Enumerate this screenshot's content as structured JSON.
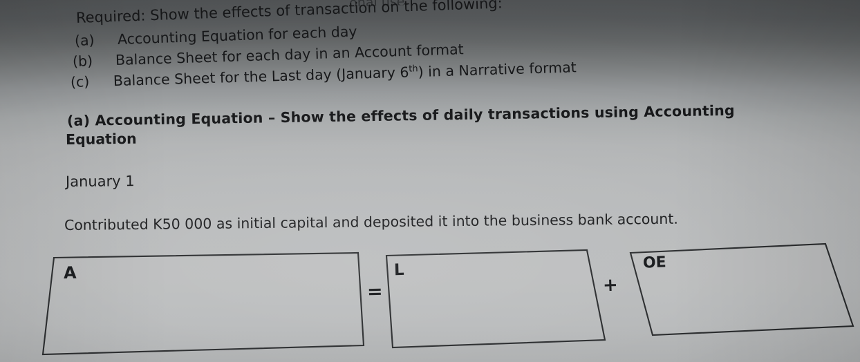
{
  "document": {
    "type": "photographed-worksheet",
    "cut_off_top_line": "...onal use.",
    "required_heading": "Required: Show the effects of transaction on the following:",
    "required_items": [
      {
        "label": "(a)",
        "text": "Accounting Equation for each day"
      },
      {
        "label": "(b)",
        "text": "Balance Sheet for each day in an Account format"
      },
      {
        "label": "(c)",
        "text": "Balance Sheet for the Last day (January 6",
        "sup": "th",
        "text_after": ") in a Narrative format"
      }
    ],
    "section_heading_line1": "(a)    Accounting  Equation  –  Show  the  effects  of  daily  transactions  using  Accounting",
    "section_heading_line2": "Equation",
    "date_heading": "January 1",
    "transaction_text": "Contributed K50 000 as initial capital and deposited it into the business bank account.",
    "equation": {
      "boxes": [
        {
          "name": "assets-box",
          "label": "A"
        },
        {
          "name": "liabilities-box",
          "label": "L"
        },
        {
          "name": "owners-equity-box",
          "label": "OE"
        }
      ],
      "operators": [
        {
          "name": "equals-operator",
          "symbol": "="
        },
        {
          "name": "plus-operator",
          "symbol": "+"
        }
      ]
    },
    "colors": {
      "paper_light": "#b8babb",
      "shadow_dark": "#55585a",
      "ink": "#17181a",
      "box_stroke": "#26282a"
    }
  }
}
